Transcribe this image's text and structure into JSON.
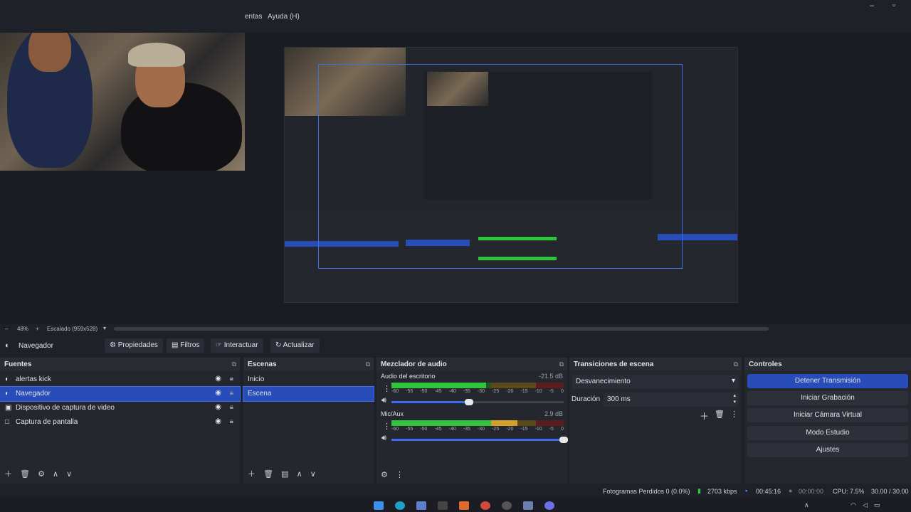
{
  "menubar": {
    "items": [
      "entas",
      "Ayuda (H)"
    ]
  },
  "preview": {
    "zoom": "48%",
    "scale": "Escalado (959x528)"
  },
  "toolbar": {
    "source": "Navegador",
    "buttons": [
      "Propiedades",
      "Filtros",
      "Interactuar",
      "Actualizar"
    ]
  },
  "sources": {
    "title": "Fuentes",
    "items": [
      {
        "label": "alertas kick",
        "icon": "browser-icon"
      },
      {
        "label": "Navegador",
        "icon": "browser-icon",
        "selected": true
      },
      {
        "label": "Dispositivo de captura de video",
        "icon": "camera-icon"
      },
      {
        "label": "Captura de pantalla",
        "icon": "monitor-icon"
      }
    ]
  },
  "scenes": {
    "title": "Escenas",
    "items": [
      {
        "label": "Inicio"
      },
      {
        "label": "Escena",
        "selected": true
      }
    ]
  },
  "mixer": {
    "title": "Mezclador de audio",
    "channels": [
      {
        "name": "Audio del escritorio",
        "db": "-21.5 dB",
        "level": 0.55,
        "volume": 0.45
      },
      {
        "name": "Mic/Aux",
        "db": "2.9 dB",
        "level": 0.73,
        "volume": 1.0
      }
    ],
    "ticks": [
      "-60",
      "-55",
      "-50",
      "-45",
      "-40",
      "-35",
      "-30",
      "-25",
      "-20",
      "-15",
      "-10",
      "-5",
      "0"
    ]
  },
  "transitions": {
    "title": "Transiciones de escena",
    "type": "Desvanecimiento",
    "duration_label": "Duración",
    "duration": "300 ms"
  },
  "controls": {
    "title": "Controles",
    "buttons": [
      "Detener Transmisión",
      "Iniciar Grabación",
      "Iniciar Cámara Virtual",
      "Modo Estudio",
      "Ajustes"
    ]
  },
  "status": {
    "dropped": "Fotogramas Perdidos 0 (0.0%)",
    "bitrate": "2703 kbps",
    "stream_time": "00:45:16",
    "rec_time": "00:00:00",
    "cpu": "CPU: 7.5%",
    "fps": "30.00 / 30.00"
  },
  "colors": {
    "accent": "#284cb8",
    "meter_green": "#2fc43c",
    "meter_yellow": "#d3a12a",
    "meter_red": "#c02d2d"
  }
}
